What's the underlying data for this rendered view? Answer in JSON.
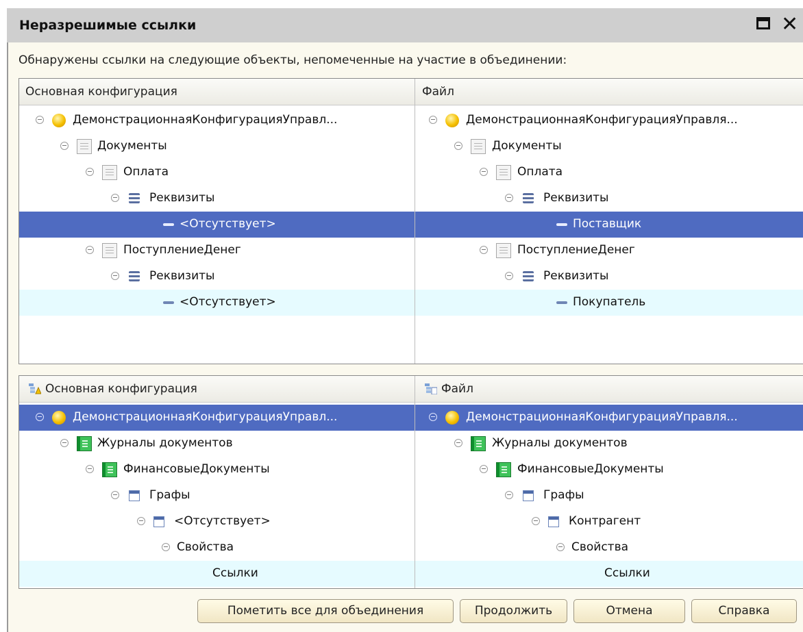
{
  "window": {
    "title": "Неразрешимые ссылки"
  },
  "message": "Обнаружены ссылки на следующие  объекты, непомеченные на участие в объединении:",
  "top_panel": {
    "left_header": "Основная конфигурация",
    "right_header": "Файл",
    "left_rows": [
      {
        "label": "ДемонстрационнаяКонфигурацияУправл...",
        "icon": "sphere-icon"
      },
      {
        "label": "Документы",
        "icon": "document-icon"
      },
      {
        "label": "Оплата",
        "icon": "document-icon"
      },
      {
        "label": "Реквизиты",
        "icon": "attributes-icon"
      },
      {
        "label": "<Отсутствует>",
        "icon": "attribute-icon"
      },
      {
        "label": "ПоступлениеДенег",
        "icon": "document-icon"
      },
      {
        "label": "Реквизиты",
        "icon": "attributes-icon"
      },
      {
        "label": "<Отсутствует>",
        "icon": "attribute-icon"
      }
    ],
    "right_rows": [
      {
        "label": "ДемонстрационнаяКонфигурацияУправля...",
        "icon": "sphere-icon"
      },
      {
        "label": "Документы",
        "icon": "document-icon"
      },
      {
        "label": "Оплата",
        "icon": "document-icon"
      },
      {
        "label": "Реквизиты",
        "icon": "attributes-icon"
      },
      {
        "label": "Поставщик",
        "icon": "attribute-icon"
      },
      {
        "label": "ПоступлениеДенег",
        "icon": "document-icon"
      },
      {
        "label": "Реквизиты",
        "icon": "attributes-icon"
      },
      {
        "label": "Покупатель",
        "icon": "attribute-icon"
      }
    ]
  },
  "bottom_panel": {
    "left_header": "Основная конфигурация",
    "right_header": "Файл",
    "left_rows": [
      {
        "label": "ДемонстрационнаяКонфигурацияУправл...",
        "icon": "sphere-icon"
      },
      {
        "label": "Журналы документов",
        "icon": "journal-icon"
      },
      {
        "label": "ФинансовыеДокументы",
        "icon": "journal-icon"
      },
      {
        "label": "Графы",
        "icon": "columns-icon"
      },
      {
        "label": "<Отсутствует>",
        "icon": "columns-icon"
      },
      {
        "label": "Свойства"
      },
      {
        "label": "Ссылки"
      }
    ],
    "right_rows": [
      {
        "label": "ДемонстрационнаяКонфигурацияУправля...",
        "icon": "sphere-icon"
      },
      {
        "label": "Журналы документов",
        "icon": "journal-icon"
      },
      {
        "label": "ФинансовыеДокументы",
        "icon": "journal-icon"
      },
      {
        "label": "Графы",
        "icon": "columns-icon"
      },
      {
        "label": "Контрагент",
        "icon": "columns-icon"
      },
      {
        "label": "Свойства"
      },
      {
        "label": "Ссылки"
      }
    ]
  },
  "buttons": {
    "mark_all": "Пометить все для объединения",
    "continue": "Продолжить",
    "cancel": "Отмена",
    "help": "Справка"
  },
  "colors": {
    "selection": "#4f6bc1",
    "alt_row": "#e6fbff",
    "titlebar": "#cfcfcf",
    "window_bg": "#fbf9ee"
  }
}
